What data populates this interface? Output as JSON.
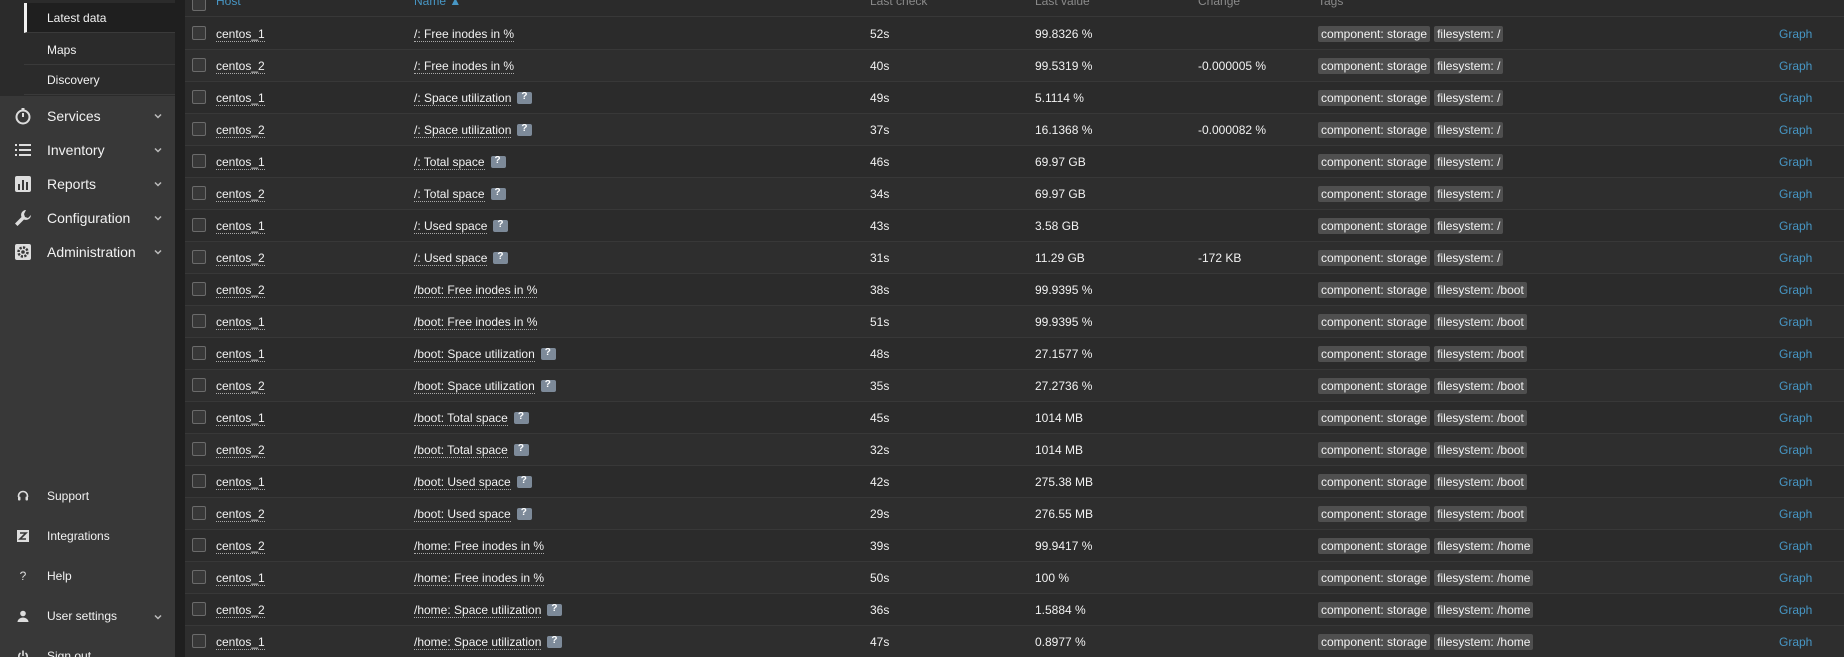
{
  "sidebar": {
    "submenu": [
      "Latest data",
      "Maps",
      "Discovery"
    ],
    "nav": [
      {
        "label": "Services",
        "icon": "stopwatch-icon"
      },
      {
        "label": "Inventory",
        "icon": "list-icon"
      },
      {
        "label": "Reports",
        "icon": "bar-chart-icon"
      },
      {
        "label": "Configuration",
        "icon": "wrench-icon"
      },
      {
        "label": "Administration",
        "icon": "cog-icon"
      }
    ],
    "bottom": [
      {
        "label": "Support",
        "icon": "headset-icon"
      },
      {
        "label": "Integrations",
        "icon": "zabbix-z-icon"
      },
      {
        "label": "Help",
        "icon": "question-icon"
      },
      {
        "label": "User settings",
        "icon": "user-icon"
      },
      {
        "label": "Sign out",
        "icon": "power-icon"
      }
    ]
  },
  "table": {
    "headers": {
      "host": "Host",
      "name": "Name ▲",
      "last_check": "Last check",
      "last_value": "Last value",
      "change": "Change",
      "tags": "Tags"
    },
    "graph_label": "Graph",
    "rows": [
      {
        "host": "centos_1",
        "name": "/: Free inodes in %",
        "hint": false,
        "last_check": "52s",
        "last_value": "99.8326 %",
        "change": "",
        "tags": [
          "component: storage",
          "filesystem: /"
        ]
      },
      {
        "host": "centos_2",
        "name": "/: Free inodes in %",
        "hint": false,
        "last_check": "40s",
        "last_value": "99.5319 %",
        "change": "-0.000005 %",
        "tags": [
          "component: storage",
          "filesystem: /"
        ]
      },
      {
        "host": "centos_1",
        "name": "/: Space utilization",
        "hint": true,
        "last_check": "49s",
        "last_value": "5.1114 %",
        "change": "",
        "tags": [
          "component: storage",
          "filesystem: /"
        ]
      },
      {
        "host": "centos_2",
        "name": "/: Space utilization",
        "hint": true,
        "last_check": "37s",
        "last_value": "16.1368 %",
        "change": "-0.000082 %",
        "tags": [
          "component: storage",
          "filesystem: /"
        ]
      },
      {
        "host": "centos_1",
        "name": "/: Total space",
        "hint": true,
        "last_check": "46s",
        "last_value": "69.97 GB",
        "change": "",
        "tags": [
          "component: storage",
          "filesystem: /"
        ]
      },
      {
        "host": "centos_2",
        "name": "/: Total space",
        "hint": true,
        "last_check": "34s",
        "last_value": "69.97 GB",
        "change": "",
        "tags": [
          "component: storage",
          "filesystem: /"
        ]
      },
      {
        "host": "centos_1",
        "name": "/: Used space",
        "hint": true,
        "last_check": "43s",
        "last_value": "3.58 GB",
        "change": "",
        "tags": [
          "component: storage",
          "filesystem: /"
        ]
      },
      {
        "host": "centos_2",
        "name": "/: Used space",
        "hint": true,
        "last_check": "31s",
        "last_value": "11.29 GB",
        "change": "-172 KB",
        "tags": [
          "component: storage",
          "filesystem: /"
        ]
      },
      {
        "host": "centos_2",
        "name": "/boot: Free inodes in %",
        "hint": false,
        "last_check": "38s",
        "last_value": "99.9395 %",
        "change": "",
        "tags": [
          "component: storage",
          "filesystem: /boot"
        ]
      },
      {
        "host": "centos_1",
        "name": "/boot: Free inodes in %",
        "hint": false,
        "last_check": "51s",
        "last_value": "99.9395 %",
        "change": "",
        "tags": [
          "component: storage",
          "filesystem: /boot"
        ]
      },
      {
        "host": "centos_1",
        "name": "/boot: Space utilization",
        "hint": true,
        "last_check": "48s",
        "last_value": "27.1577 %",
        "change": "",
        "tags": [
          "component: storage",
          "filesystem: /boot"
        ]
      },
      {
        "host": "centos_2",
        "name": "/boot: Space utilization",
        "hint": true,
        "last_check": "35s",
        "last_value": "27.2736 %",
        "change": "",
        "tags": [
          "component: storage",
          "filesystem: /boot"
        ]
      },
      {
        "host": "centos_1",
        "name": "/boot: Total space",
        "hint": true,
        "last_check": "45s",
        "last_value": "1014 MB",
        "change": "",
        "tags": [
          "component: storage",
          "filesystem: /boot"
        ]
      },
      {
        "host": "centos_2",
        "name": "/boot: Total space",
        "hint": true,
        "last_check": "32s",
        "last_value": "1014 MB",
        "change": "",
        "tags": [
          "component: storage",
          "filesystem: /boot"
        ]
      },
      {
        "host": "centos_1",
        "name": "/boot: Used space",
        "hint": true,
        "last_check": "42s",
        "last_value": "275.38 MB",
        "change": "",
        "tags": [
          "component: storage",
          "filesystem: /boot"
        ]
      },
      {
        "host": "centos_2",
        "name": "/boot: Used space",
        "hint": true,
        "last_check": "29s",
        "last_value": "276.55 MB",
        "change": "",
        "tags": [
          "component: storage",
          "filesystem: /boot"
        ]
      },
      {
        "host": "centos_2",
        "name": "/home: Free inodes in %",
        "hint": false,
        "last_check": "39s",
        "last_value": "99.9417 %",
        "change": "",
        "tags": [
          "component: storage",
          "filesystem: /home"
        ]
      },
      {
        "host": "centos_1",
        "name": "/home: Free inodes in %",
        "hint": false,
        "last_check": "50s",
        "last_value": "100 %",
        "change": "",
        "tags": [
          "component: storage",
          "filesystem: /home"
        ]
      },
      {
        "host": "centos_2",
        "name": "/home: Space utilization",
        "hint": true,
        "last_check": "36s",
        "last_value": "1.5884 %",
        "change": "",
        "tags": [
          "component: storage",
          "filesystem: /home"
        ]
      },
      {
        "host": "centos_1",
        "name": "/home: Space utilization",
        "hint": true,
        "last_check": "47s",
        "last_value": "0.8977 %",
        "change": "",
        "tags": [
          "component: storage",
          "filesystem: /home"
        ]
      }
    ]
  }
}
